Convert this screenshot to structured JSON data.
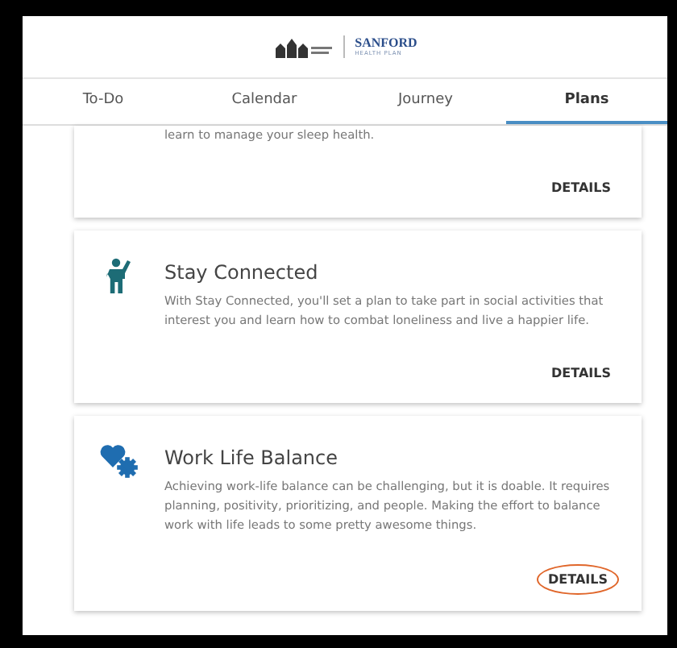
{
  "header": {
    "brand": "SANFORD",
    "brand_sub": "HEALTH PLAN"
  },
  "tabs": [
    {
      "label": "To-Do",
      "selected": false
    },
    {
      "label": "Calendar",
      "selected": false
    },
    {
      "label": "Journey",
      "selected": false
    },
    {
      "label": "Plans",
      "selected": true
    }
  ],
  "plans": [
    {
      "kind": "partial",
      "description": "learn to manage your sleep health.",
      "action": "DETAILS",
      "circled": false
    },
    {
      "kind": "person",
      "title": "Stay Connected",
      "description": "With Stay Connected, you'll set a plan to take part in social activities that interest you and learn how to combat loneliness and live a happier life.",
      "action": "DETAILS",
      "circled": false
    },
    {
      "kind": "heartgear",
      "title": "Work Life Balance",
      "description": "Achieving work-life balance can be challenging, but it is doable. It requires planning, positivity, prioritizing, and people. Making the effort to balance work with life leads to some pretty awesome things.",
      "action": "DETAILS",
      "circled": true
    }
  ]
}
